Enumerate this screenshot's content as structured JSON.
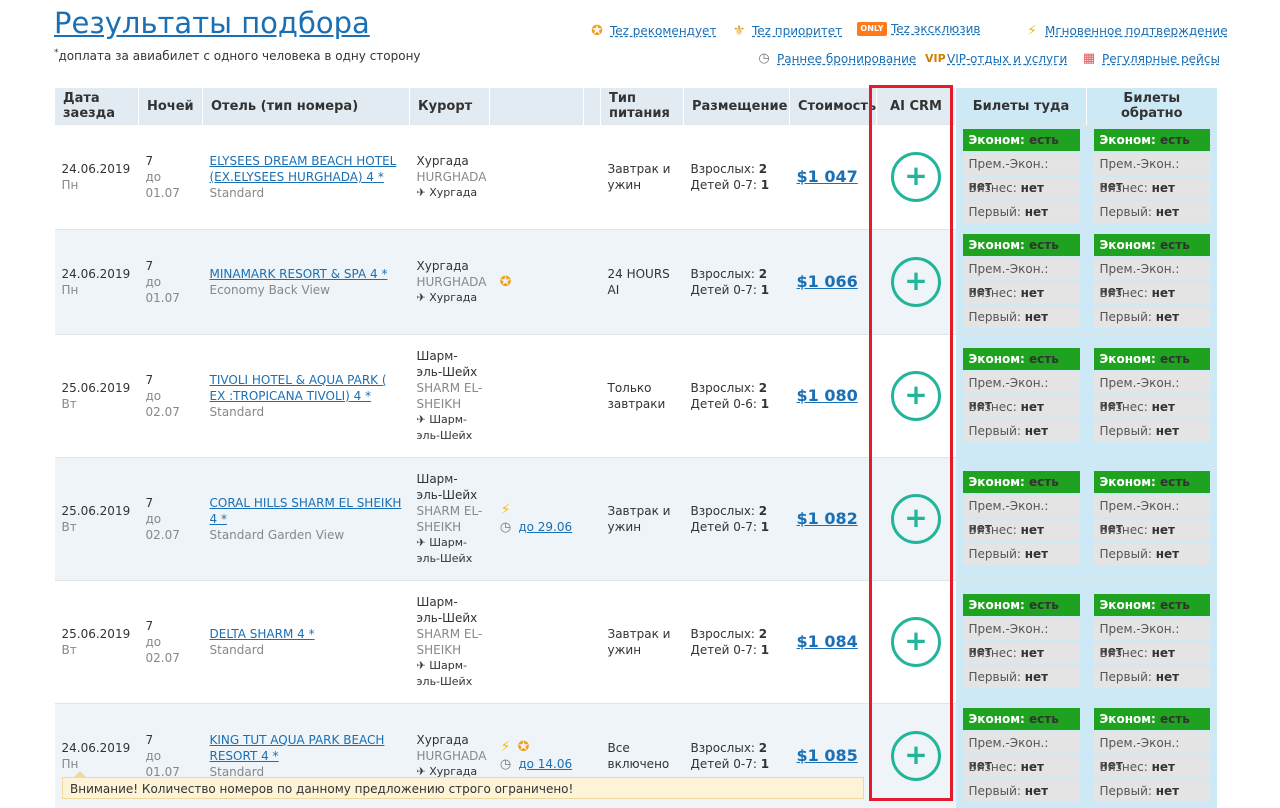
{
  "page": {
    "title": "Результаты подбора",
    "note_mark": "*",
    "note": "доплата за авиабилет с одного человека в одну сторону"
  },
  "legend": {
    "recommend": "Tez рекомендует",
    "priority": "Tez приоритет",
    "only_badge": "ONLY",
    "exclusive": "Tez эксклюзив",
    "instant": "Мгновенное подтверждение",
    "early": "Раннее бронирование",
    "vip_badge": "VIP",
    "vip": "VIP-отдых и услуги",
    "regular": "Регулярные рейсы"
  },
  "table": {
    "headers": {
      "date": "Дата заезда",
      "nights": "Ночей",
      "hotel": "Отель (тип номера)",
      "resort": "Курорт",
      "meal": "Тип питания",
      "placement": "Размещение",
      "price": "Стоимость",
      "crm": "AI CRM",
      "tickets_to": "Билеты туда",
      "tickets_back": "Билеты обратно"
    },
    "labels": {
      "adults": "Взрослых:",
      "econ": "Эконом:",
      "prem": "Прем.-Экон.:",
      "business": "Бизнес:",
      "first": "Первый:",
      "yes": "есть",
      "no": "нет"
    },
    "rows": [
      {
        "date": "24.06.2019",
        "dow": "Пн",
        "nights": "7",
        "until": "до 01.07",
        "hotel": "ELYSEES DREAM BEACH HOTEL (EX.ELYSEES HURGHADA) 4 *",
        "room": "Standard",
        "resort": "Хургада",
        "resort_en": "HURGHADA",
        "transfer": "Хургада",
        "meal": "Завтрак и ужин",
        "adults": "2",
        "kids_label": "Детей 0-7:",
        "kids": "1",
        "price": "$1 047",
        "icons": "",
        "early": ""
      },
      {
        "date": "24.06.2019",
        "dow": "Пн",
        "nights": "7",
        "until": "до 01.07",
        "hotel": "MINAMARK RESORT & SPA 4 *",
        "room": "Economy Back View",
        "resort": "Хургада",
        "resort_en": "HURGHADA",
        "transfer": "Хургада",
        "meal": "24 HOURS AI",
        "adults": "2",
        "kids_label": "Детей 0-7:",
        "kids": "1",
        "price": "$1 066",
        "icons": "star",
        "early": ""
      },
      {
        "date": "25.06.2019",
        "dow": "Вт",
        "nights": "7",
        "until": "до 02.07",
        "hotel": "TIVOLI HOTEL & AQUA PARK ( EX :TROPICANA TIVOLI) 4 *",
        "room": "Standard",
        "resort": "Шарм-эль-Шейх",
        "resort_en": "SHARM EL-SHEIKH",
        "transfer": "Шарм-эль-Шейх",
        "meal": "Только завтраки",
        "adults": "2",
        "kids_label": "Детей 0-6:",
        "kids": "1",
        "price": "$1 080",
        "icons": "",
        "early": ""
      },
      {
        "date": "25.06.2019",
        "dow": "Вт",
        "nights": "7",
        "until": "до 02.07",
        "hotel": "CORAL HILLS SHARM EL SHEIKH 4 *",
        "room": "Standard Garden View",
        "resort": "Шарм-эль-Шейх",
        "resort_en": "SHARM EL-SHEIKH",
        "transfer": "Шарм-эль-Шейх",
        "meal": "Завтрак и ужин",
        "adults": "2",
        "kids_label": "Детей 0-7:",
        "kids": "1",
        "price": "$1 082",
        "icons": "bolt",
        "early": "до 29.06"
      },
      {
        "date": "25.06.2019",
        "dow": "Вт",
        "nights": "7",
        "until": "до 02.07",
        "hotel": "DELTA SHARM 4 *",
        "room": "Standard",
        "resort": "Шарм-эль-Шейх",
        "resort_en": "SHARM EL-SHEIKH",
        "transfer": "Шарм-эль-Шейх",
        "meal": "Завтрак и ужин",
        "adults": "2",
        "kids_label": "Детей 0-7:",
        "kids": "1",
        "price": "$1 084",
        "icons": "",
        "early": ""
      },
      {
        "date": "24.06.2019",
        "dow": "Пн",
        "nights": "7",
        "until": "до 01.07",
        "hotel": "KING TUT AQUA PARK BEACH RESORT 4 *",
        "room": "Standard",
        "resort": "Хургада",
        "resort_en": "HURGHADA",
        "transfer": "Хургада",
        "meal": "Все включено",
        "adults": "2",
        "kids_label": "Детей 0-7:",
        "kids": "1",
        "price": "$1 085",
        "icons": "bolt,star",
        "early": "до 14.06"
      }
    ]
  },
  "warning": "Внимание! Количество номеров по данному предложению строго ограничено!",
  "icons": {
    "plus": "plus-circle-icon",
    "transfer": "plane-icon"
  },
  "colors": {
    "accent": "#22b59a",
    "available": "#1fa21f",
    "highlight": "#e21c2a",
    "link": "#1a6fb5"
  }
}
